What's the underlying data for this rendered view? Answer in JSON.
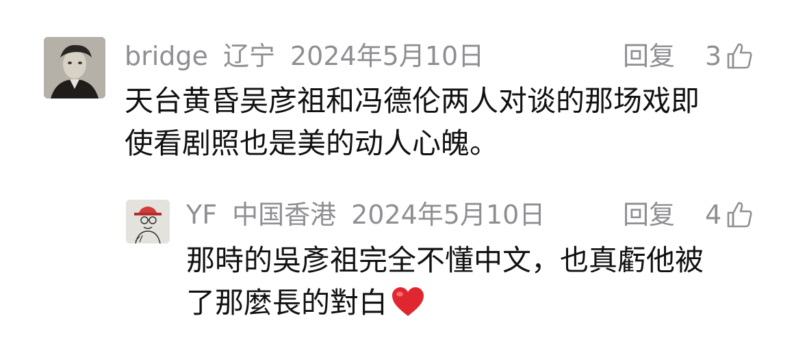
{
  "comments": [
    {
      "username": "bridge",
      "location": "辽宁",
      "date": "2024年5月10日",
      "reply_label": "回复",
      "like_count": "3",
      "text_lines": [
        "天台黄昏吴彦祖和冯德伦两人对谈的那场戏即",
        "使看剧照也是美的动人心魄。"
      ]
    },
    {
      "username": "YF",
      "location": "中国香港",
      "date": "2024年5月10日",
      "reply_label": "回复",
      "like_count": "4",
      "text_lines": [
        "那時的吳彥祖完全不懂中文，也真虧他被",
        "了那麼長的對白"
      ]
    }
  ],
  "colors": {
    "meta_gray": "#8e8e93",
    "body_text": "#111111",
    "heart_red": "#e0262f"
  },
  "icons": {
    "like": "thumbs-up-outline-icon",
    "heart": "red-heart-emoji"
  }
}
